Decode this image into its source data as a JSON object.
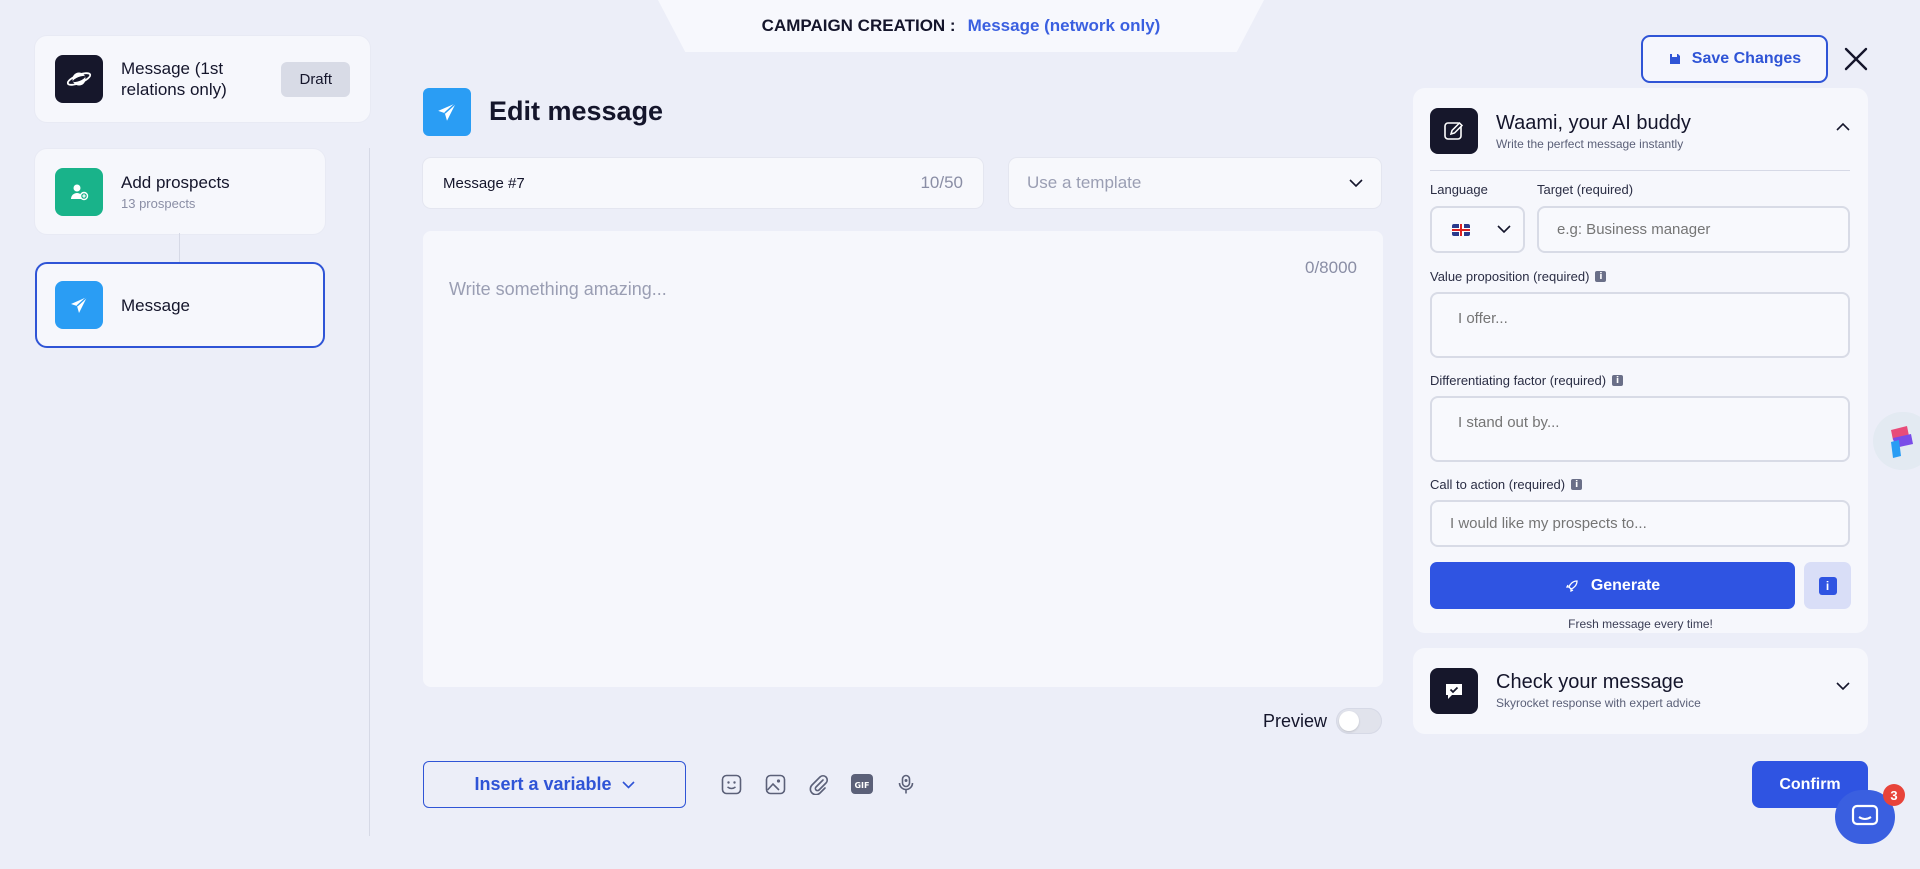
{
  "banner": {
    "prefix": "CAMPAIGN CREATION :",
    "campaign_type": "Message (network only)"
  },
  "header": {
    "save_label": "Save Changes"
  },
  "steps": [
    {
      "title": "Message (1st relations only)",
      "badge": "Draft"
    },
    {
      "title": "Add prospects",
      "subtitle": "13 prospects"
    },
    {
      "title": "Message"
    }
  ],
  "editor": {
    "title": "Edit message",
    "message_name": "Message #7",
    "name_count": "10/50",
    "template_placeholder": "Use a template",
    "body_placeholder": "Write something amazing...",
    "body_count": "0/8000",
    "preview_label": "Preview",
    "insert_variable_label": "Insert a variable",
    "confirm_label": "Confirm"
  },
  "ai": {
    "title": "Waami, your AI buddy",
    "subtitle": "Write the perfect message instantly",
    "language_label": "Language",
    "target_label": "Target (required)",
    "target_placeholder": "e.g: Business manager",
    "value_label": "Value proposition (required)",
    "value_placeholder": "I offer...",
    "diff_label": "Differentiating factor (required)",
    "diff_placeholder": "I stand out by...",
    "cta_label": "Call to action (required)",
    "cta_placeholder": "I would like my prospects to...",
    "generate_label": "Generate",
    "fresh_note": "Fresh message every time!"
  },
  "check": {
    "title": "Check your message",
    "subtitle": "Skyrocket response with expert advice"
  },
  "chat": {
    "badge_count": "3"
  },
  "colors": {
    "primary": "#2f54e2",
    "dark": "#16172b",
    "teal": "#19b38a",
    "sky": "#2a9df4",
    "background": "#eceef8"
  }
}
